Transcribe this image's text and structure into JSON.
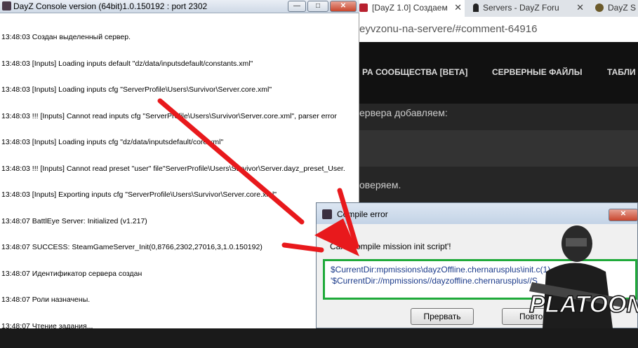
{
  "console": {
    "title": "DayZ Console version (64bit)1.0.150192 : port 2302",
    "controls": {
      "minimize": "—",
      "maximize": "□",
      "close": "✕"
    },
    "lines": [
      "13:48:03 Создан выделенный сервер.",
      "13:48:03 [Inputs] Loading inputs default \"dz/data/inputsdefault/constants.xml\"",
      "13:48:03 [Inputs] Loading inputs cfg \"ServerProfile\\Users\\Survivor\\Server.core.xml\"",
      "13:48:03 !!! [Inputs] Cannot read inputs cfg \"ServerProfile\\Users\\Survivor\\Server.core.xml\", parser error",
      "13:48:03 [Inputs] Loading inputs cfg \"dz/data/inputsdefault/core.xml\"",
      "13:48:03 !!! [Inputs] Cannot read preset \"user\" file\"ServerProfile\\Users\\Survivor\\Server.dayz_preset_User.",
      "13:48:03 [Inputs] Exporting inputs cfg \"ServerProfile\\Users\\Survivor\\Server.core.xml\"",
      "13:48:07 BattlEye Server: Initialized (v1.217)",
      "13:48:07 SUCCESS: SteamGameServer_Init(0,8766,2302,27016,3,1.0.150192)",
      "13:48:07 Идентификатор сервера создан",
      "13:48:07 Роли назначены.",
      "13:48:07 Чтение задания..."
    ]
  },
  "browser": {
    "tabs": [
      {
        "label": "[DayZ 1.0] Создаем",
        "icon": "dayz-s-icon"
      },
      {
        "label": "Servers - DayZ Foru",
        "icon": "survivor-icon"
      },
      {
        "label": "DayZ S",
        "icon": "dayz-logo-icon"
      }
    ],
    "tab_close": "✕",
    "address": "eyvzonu-na-servere/#comment-64916",
    "nav": [
      "РА СООБЩЕСТВА [BETA]",
      "СЕРВЕРНЫЕ ФАЙЛЫ",
      "ТАБЛИ"
    ],
    "text1": "ервера добавляем:",
    "text2": "оверяем."
  },
  "dialog": {
    "title": "Compile error",
    "close": "✕",
    "message": "Can't compile mission init script'!",
    "path1": "$CurrentDir:mpmissions\\dayzOffline.chernarusplus\\init.c(1)",
    "path2": "'$CurrentDir://mpmissions//dayzoffline.chernarusplus//S",
    "buttons": {
      "abort": "Прервать",
      "retry": "Повтор"
    }
  },
  "watermark": {
    "text": "PLATOON"
  },
  "colors": {
    "highlight": "#1faa3a",
    "arrow": "#e8191c"
  }
}
